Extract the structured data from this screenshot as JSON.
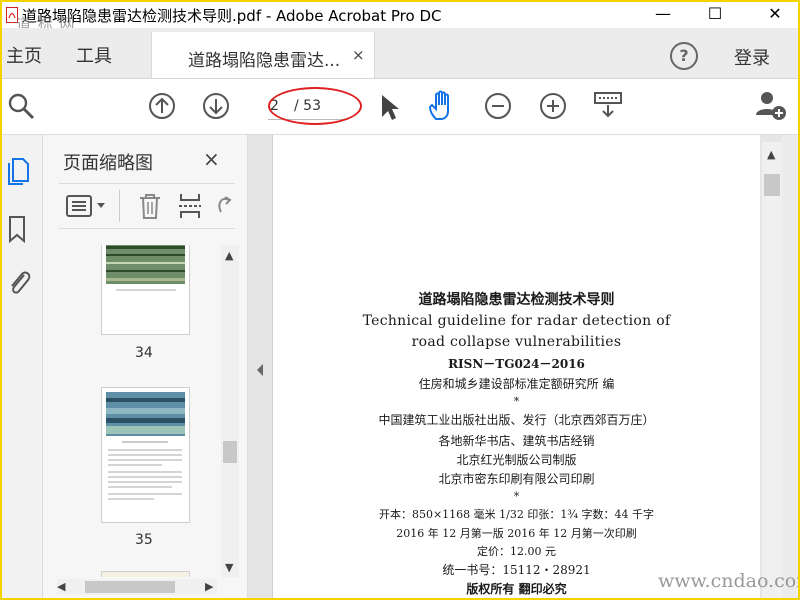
{
  "window": {
    "title": "道路塌陷隐患雷达检测技术导则.pdf - Adobe Acrobat Pro DC",
    "minimize": "—",
    "maximize": "☐",
    "close": "✕",
    "watermark_top": "道 标 网"
  },
  "menubar": {
    "home": "主页",
    "tools": "工具",
    "tab_label": "道路塌陷隐患雷达...",
    "tab_close": "×",
    "help": "?",
    "login": "登录"
  },
  "toolbar": {
    "current_page": "2",
    "page_total": "/ 53"
  },
  "thumbnails": {
    "title": "页面缩略图",
    "close": "×",
    "pages": [
      {
        "number": "34"
      },
      {
        "number": "35"
      }
    ]
  },
  "document": {
    "title_cn": "道路塌陷隐患雷达检测技术导则",
    "title_en_1": "Technical guideline for radar detection of",
    "title_en_2": "road collapse vulnerabilities",
    "code": "RISN－TG024－2016",
    "editor": "住房和城乡建设部标准定额研究所   编",
    "star1": "*",
    "publisher": "中国建筑工业出版社出版、发行（北京西郊百万庄）",
    "distributor": "各地新华书店、建筑书店经销",
    "typeset": "北京红光制版公司制版",
    "printer": "北京市密东印刷有限公司印刷",
    "star2": "*",
    "format": "开本：850×1168 毫米  1/32  印张：1¾  字数：44 千字",
    "edition": "2016 年 12 月第一版    2016 年 12 月第一次印刷",
    "price": "定价：12.00 元",
    "isbn": "统一书号：15112・28921",
    "rights": "版权所有  翻印必究"
  },
  "watermark_bottom": "www.cndao.com",
  "colors": {
    "accent": "#1473e6",
    "annotation": "#e02020",
    "window_border": "#f4d400"
  }
}
